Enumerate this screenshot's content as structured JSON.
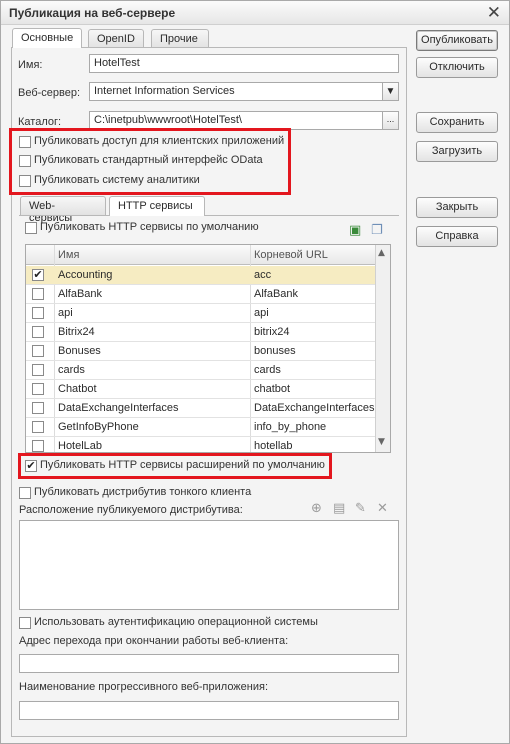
{
  "window": {
    "title": "Публикация на веб-сервере",
    "close_glyph": "✕"
  },
  "tabs": [
    "Основные",
    "OpenID",
    "Прочие"
  ],
  "fields": {
    "name_label": "Имя:",
    "name_value": "HotelTest",
    "webserver_label": "Веб-сервер:",
    "webserver_value": "Internet Information Services",
    "catalog_label": "Каталог:",
    "catalog_value": "C:\\inetpub\\wwwroot\\HotelTest\\",
    "browse_glyph": "..."
  },
  "publish_checks": [
    {
      "label": "Публиковать доступ для клиентских приложений",
      "checked": false
    },
    {
      "label": "Публиковать стандартный интерфейс OData",
      "checked": false
    },
    {
      "label": "Публиковать систему аналитики",
      "checked": false
    }
  ],
  "subtabs": [
    "Web-сервисы",
    "HTTP сервисы"
  ],
  "http": {
    "default_label": "Публиковать HTTP сервисы по умолчанию",
    "columns": [
      "Имя",
      "Корневой URL"
    ],
    "rows": [
      {
        "name": "Accounting",
        "url": "acc",
        "checked": true
      },
      {
        "name": "AlfaBank",
        "url": "AlfaBank",
        "checked": false
      },
      {
        "name": "api",
        "url": "api",
        "checked": false
      },
      {
        "name": "Bitrix24",
        "url": "bitrix24",
        "checked": false
      },
      {
        "name": "Bonuses",
        "url": "bonuses",
        "checked": false
      },
      {
        "name": "cards",
        "url": "cards",
        "checked": false
      },
      {
        "name": "Chatbot",
        "url": "chatbot",
        "checked": false
      },
      {
        "name": "DataExchangeInterfaces",
        "url": "DataExchangeInterfaces",
        "checked": false
      },
      {
        "name": "GetInfoByPhone",
        "url": "info_by_phone",
        "checked": false
      },
      {
        "name": "HotelLab",
        "url": "hotellab",
        "checked": false
      }
    ],
    "extensions_label": "Публиковать HTTP сервисы расширений по умолчанию"
  },
  "thin_client": {
    "publish_label": "Публиковать дистрибутив тонкого клиента",
    "location_label": "Расположение публикуемого дистрибутива:"
  },
  "os_auth_label": "Использовать аутентификацию операционной системы",
  "redirect_label": "Адрес перехода при окончании работы веб-клиента:",
  "pwa_label": "Наименование прогрессивного веб-приложения:",
  "buttons": {
    "publish": "Опубликовать",
    "disable": "Отключить",
    "save": "Сохранить",
    "load": "Загрузить",
    "close": "Закрыть",
    "help": "Справка"
  },
  "glyphs": {
    "check": "✔",
    "dropdown": "▼",
    "scroll_up": "▲",
    "scroll_down": "▼"
  },
  "colors": {
    "highlight": "#e3161e",
    "selected_row": "#f6ecc2"
  }
}
